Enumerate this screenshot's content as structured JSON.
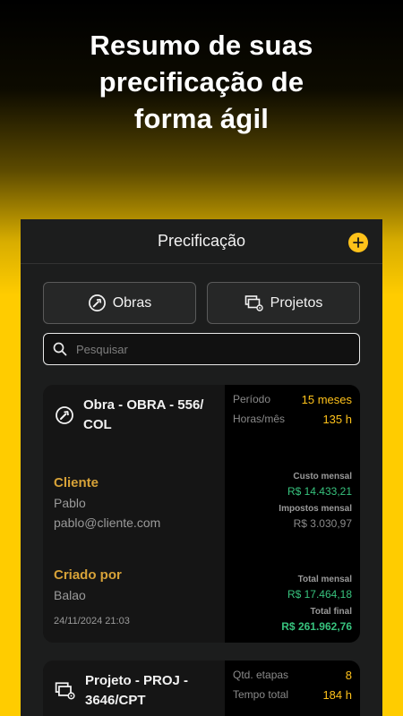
{
  "headline": "Resumo de suas\nprecificação de\nforma ágil",
  "appbar": {
    "title": "Precificação"
  },
  "tabs": [
    {
      "label": "Obras",
      "icon": "hammer-icon"
    },
    {
      "label": "Projetos",
      "icon": "projects-icon"
    }
  ],
  "search": {
    "placeholder": "Pesquisar"
  },
  "cards": [
    {
      "title": "Obra - OBRA - 556/ COL",
      "stats": [
        {
          "label": "Período",
          "value": "15 meses"
        },
        {
          "label": "Horas/mês",
          "value": "135 h"
        }
      ],
      "cliente_label": "Cliente",
      "cliente_name": "Pablo",
      "cliente_email": "pablo@cliente.com",
      "criado_label": "Criado por",
      "criado_name": "Balao",
      "date": "24/11/2024 21:03",
      "custo_label": "Custo mensal",
      "custo_value": "R$ 14.433,21",
      "impostos_label": "Impostos mensal",
      "impostos_value": "R$ 3.030,97",
      "total_mensal_label": "Total mensal",
      "total_mensal_value": "R$ 17.464,18",
      "total_final_label": "Total final",
      "total_final_value": "R$ 261.962,76"
    },
    {
      "title": "Projeto - PROJ - 3646/CPT",
      "stats": [
        {
          "label": "Qtd. etapas",
          "value": "8"
        },
        {
          "label": "Tempo total",
          "value": "184 h"
        }
      ]
    }
  ],
  "colors": {
    "accent": "#ffc21a",
    "gold": "#d7a238",
    "green": "#37c27d",
    "card_bg": "#151515"
  }
}
